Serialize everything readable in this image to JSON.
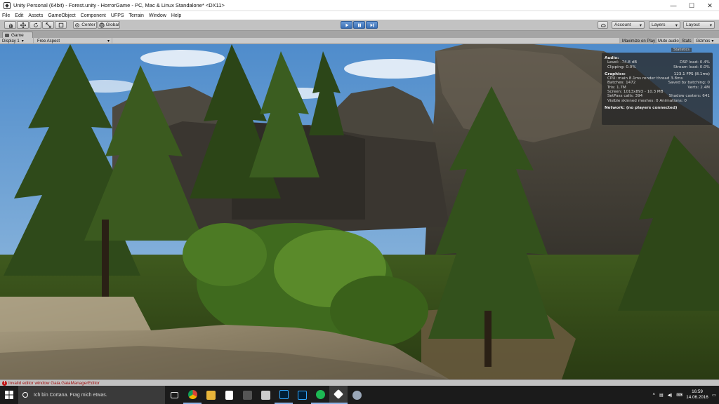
{
  "window": {
    "title": "Unity Personal (64bit) - Forest.unity - HorrorGame - PC, Mac & Linux Standalone* <DX11>",
    "controls": {
      "minimize": "—",
      "maximize": "☐",
      "close": "✕"
    }
  },
  "menu": [
    "File",
    "Edit",
    "Assets",
    "GameObject",
    "Component",
    "UFPS",
    "Terrain",
    "Window",
    "Help"
  ],
  "toolbar": {
    "pivot_label": "Center",
    "space_label": "Global",
    "account_label": "Account",
    "layers_label": "Layers",
    "layout_label": "Layout",
    "play_state": "playing"
  },
  "game_tab": {
    "label": "Game"
  },
  "game_bar": {
    "display": "Display 1",
    "aspect": "Free Aspect",
    "maximize_on_play": "Maximize on Play",
    "mute_audio": "Mute audio",
    "stats": "Stats",
    "gizmos": "Gizmos"
  },
  "stats": {
    "label": "Statistics",
    "audio_title": "Audio:",
    "level": "Level: -74.8 dB",
    "dsp_load": "DSP load: 0.4%",
    "clipping": "Clipping: 0.0%",
    "stream_load": "Stream load: 0.0%",
    "graphics_title": "Graphics:",
    "fps": "123.1 FPS (8.1ms)",
    "cpu": "CPU: main 8.1ms  render thread 3.8ms",
    "batches": "Batches: 1472",
    "saved_batching": "Saved by batching: 0",
    "tris": "Tris: 1.7M",
    "verts": "Verts: 2.4M",
    "screen": "Screen: 1013x893 - 10.3 MB",
    "setpass": "SetPass calls: 394",
    "shadow_casters": "Shadow casters: 641",
    "skinned": "Visible skinned meshes: 0  Animations: 0",
    "network": "Network: (no players connected)"
  },
  "console": {
    "error_message": "Invalid editor window Gaia.GaiaManagerEditor"
  },
  "taskbar": {
    "search_placeholder": "Ich bin Cortana. Frag mich etwas.",
    "time": "16:59",
    "date": "14.06.2016",
    "apps": [
      "task-view",
      "chrome",
      "explorer",
      "store",
      "unity-hub",
      "app-s",
      "photoshop",
      "photoshop",
      "spotify",
      "unity",
      "misc"
    ]
  },
  "colors": {
    "play_active": "#3a6fb4",
    "error": "#c01818",
    "taskbar_bg": "#1b1b1b"
  }
}
